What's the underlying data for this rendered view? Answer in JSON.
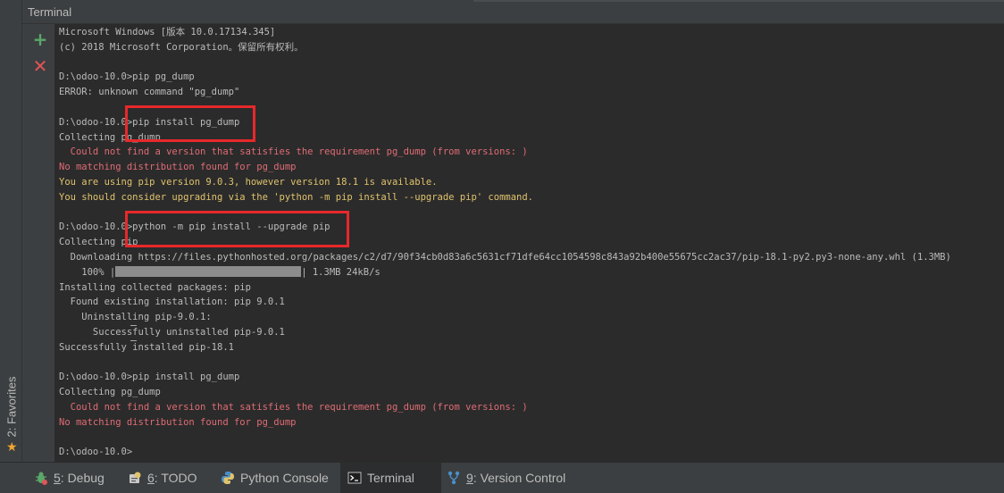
{
  "window": {
    "title": "Terminal"
  },
  "favorites": {
    "label": "2: Favorites"
  },
  "toolbar": {
    "new_session": "+",
    "close_session": "✕"
  },
  "terminal": {
    "lines": [
      {
        "text": "Microsoft Windows [版本 10.0.17134.345]",
        "style": "normal"
      },
      {
        "text": "(c) 2018 Microsoft Corporation。保留所有权利。",
        "style": "normal"
      },
      {
        "text": "",
        "style": "normal"
      },
      {
        "text": "D:\\odoo-10.0>pip pg_dump",
        "style": "normal"
      },
      {
        "text": "ERROR: unknown command \"pg_dump\"",
        "style": "normal"
      },
      {
        "text": "",
        "style": "normal"
      },
      {
        "text": "D:\\odoo-10.0>pip install pg_dump",
        "style": "normal"
      },
      {
        "text": "Collecting pg_dump",
        "style": "normal"
      },
      {
        "text": "  Could not find a version that satisfies the requirement pg_dump (from versions: )",
        "style": "err"
      },
      {
        "text": "No matching distribution found for pg_dump",
        "style": "err"
      },
      {
        "text": "You are using pip version 9.0.3, however version 18.1 is available.",
        "style": "warn"
      },
      {
        "text": "You should consider upgrading via the 'python -m pip install --upgrade pip' command.",
        "style": "warn"
      },
      {
        "text": "",
        "style": "normal"
      },
      {
        "text": "D:\\odoo-10.0>python -m pip install --upgrade pip",
        "style": "normal"
      },
      {
        "text": "Collecting pip",
        "style": "normal"
      },
      {
        "text": "  Downloading https://files.pythonhosted.org/packages/c2/d7/90f34cb0d83a6c5631cf71dfe64cc1054598c843a92b400e55675cc2ac37/pip-18.1-py2.py3-none-any.whl (1.3MB)",
        "style": "normal"
      },
      {
        "text": "PROGRESS",
        "style": "progress"
      },
      {
        "text": "Installing collected packages: pip",
        "style": "normal"
      },
      {
        "text": "  Found existing installation: pip 9.0.1",
        "style": "normal"
      },
      {
        "text": "    Uninstalling pip-9.0.1:",
        "style": "normal"
      },
      {
        "text": "      Successfully uninstalled pip-9.0.1",
        "style": "normal"
      },
      {
        "text": "Successfully installed pip-18.1",
        "style": "normal"
      },
      {
        "text": "",
        "style": "normal"
      },
      {
        "text": "D:\\odoo-10.0>pip install pg_dump",
        "style": "normal"
      },
      {
        "text": "Collecting pg_dump",
        "style": "normal"
      },
      {
        "text": "  Could not find a version that satisfies the requirement pg_dump (from versions: )",
        "style": "err"
      },
      {
        "text": "No matching distribution found for pg_dump",
        "style": "err"
      },
      {
        "text": "",
        "style": "normal"
      },
      {
        "text": "D:\\odoo-10.0>",
        "style": "normal"
      }
    ],
    "progress": {
      "percent_label": "    100% |",
      "end": "| 1.3MB 24kB/s",
      "value": 1.0
    }
  },
  "statusbar": {
    "tabs": [
      {
        "key": "5",
        "rest": ": Debug",
        "icon": "debug-icon",
        "active": false
      },
      {
        "key": "6",
        "rest": ": TODO",
        "icon": "todo-icon",
        "active": false
      },
      {
        "key": "",
        "rest": "Python Console",
        "icon": "python-icon",
        "active": false
      },
      {
        "key": "",
        "rest": "Terminal",
        "icon": "terminal-icon",
        "active": true
      },
      {
        "key": "9",
        "rest": ": Version Control",
        "icon": "vcs-icon",
        "active": false
      }
    ]
  },
  "colors": {
    "background": "#2b2b2b",
    "error": "#e06c75",
    "warning": "#e0c36d",
    "highlight": "#e8282b"
  }
}
